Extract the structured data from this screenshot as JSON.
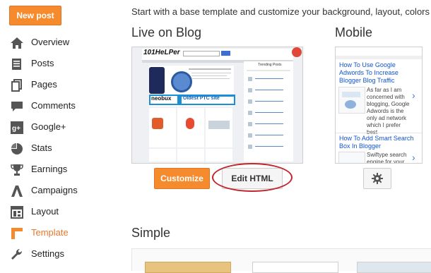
{
  "new_post_label": "New post",
  "nav": [
    {
      "label": "Overview",
      "icon": "home-icon"
    },
    {
      "label": "Posts",
      "icon": "posts-icon"
    },
    {
      "label": "Pages",
      "icon": "pages-icon"
    },
    {
      "label": "Comments",
      "icon": "comments-icon"
    },
    {
      "label": "Google+",
      "icon": "google-plus-icon"
    },
    {
      "label": "Stats",
      "icon": "stats-icon"
    },
    {
      "label": "Earnings",
      "icon": "trophy-icon"
    },
    {
      "label": "Campaigns",
      "icon": "campaigns-icon"
    },
    {
      "label": "Layout",
      "icon": "layout-icon"
    },
    {
      "label": "Template",
      "icon": "template-icon",
      "active": true
    },
    {
      "label": "Settings",
      "icon": "wrench-icon"
    }
  ],
  "intro": "Start with a base template and customize your background, layout, colors",
  "live_title": "Live on Blog",
  "mobile_title": "Mobile",
  "simple_title": "Simple",
  "customize_label": "Customize",
  "edit_html_label": "Edit HTML",
  "accent_color": "#f58b2c",
  "highlight_color": "#c0262c",
  "live_preview": {
    "logo": "101HeLPer",
    "ad_text": "neobux",
    "ad_tagline": "Oldest PTC site",
    "widget_title": "Trending Posts"
  },
  "mobile_preview": {
    "post1_title": "How To Use Google Adwords To Increase Blogger Blog Traffic",
    "post1_excerpt": "As far as I am concerned with blogging, Google Adwords is the only ad network which I prefer best",
    "post2_title": "How To Add Smart Search Box In Blogger",
    "post2_excerpt": "Swiftype search engine for your"
  }
}
